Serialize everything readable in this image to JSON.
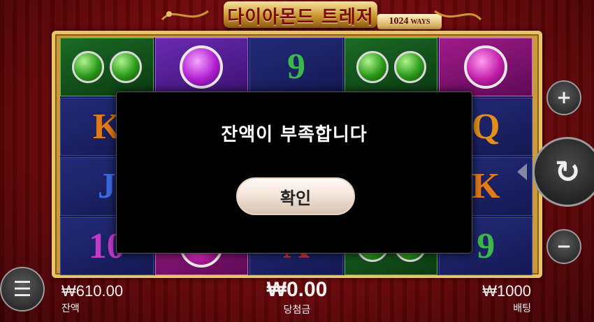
{
  "game": {
    "title": "다이아몬드 트레저",
    "ways_number": "1024",
    "ways_label": "WAYS"
  },
  "reels": [
    [
      {
        "symbol": "emerald-earrings",
        "type": "green"
      },
      {
        "symbol": "amethyst-ring",
        "type": "purple"
      },
      {
        "symbol": "9",
        "type": "letter"
      },
      {
        "symbol": "emerald-earrings",
        "type": "green"
      },
      {
        "symbol": "ruby-ring",
        "type": "pink"
      }
    ],
    [
      {
        "symbol": "K",
        "type": "letter"
      },
      {
        "symbol": "",
        "type": "blank"
      },
      {
        "symbol": "",
        "type": "blank"
      },
      {
        "symbol": "",
        "type": "blank"
      },
      {
        "symbol": "Q",
        "type": "letter"
      }
    ],
    [
      {
        "symbol": "J",
        "type": "letter"
      },
      {
        "symbol": "",
        "type": "blank"
      },
      {
        "symbol": "",
        "type": "blank"
      },
      {
        "symbol": "",
        "type": "blank"
      },
      {
        "symbol": "K",
        "type": "letter"
      }
    ],
    [
      {
        "symbol": "10",
        "type": "letter"
      },
      {
        "symbol": "ruby-ring",
        "type": "pink"
      },
      {
        "symbol": "A",
        "type": "letter"
      },
      {
        "symbol": "emerald-earrings",
        "type": "green"
      },
      {
        "symbol": "9",
        "type": "letter"
      }
    ]
  ],
  "controls": {
    "plus_icon": "+",
    "minus_icon": "−",
    "spin_icon": "↻",
    "menu_icon": "☰"
  },
  "info": {
    "balance_value": "₩610.00",
    "balance_label": "잔액",
    "win_value": "₩0.00",
    "win_label": "당첨금",
    "bet_value": "₩1000",
    "bet_label": "배팅"
  },
  "dialog": {
    "message": "잔액이 부족합니다",
    "confirm_label": "확인"
  },
  "colors": {
    "background": "#7a0a0d",
    "frame_gold": "#e7c46a",
    "reel_blue": "#1c2266"
  }
}
